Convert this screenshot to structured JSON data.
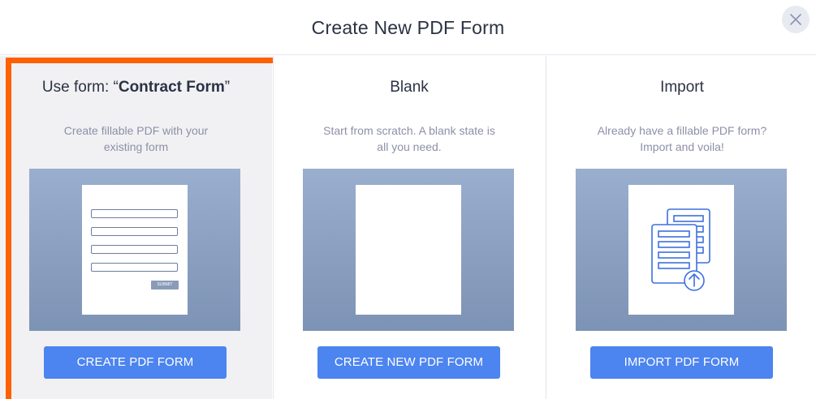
{
  "header": {
    "title": "Create New PDF Form",
    "close_icon": "close-icon"
  },
  "cards": [
    {
      "title_prefix": "Use form: “",
      "title_bold": "Contract Form",
      "title_suffix": "”",
      "description": "Create fillable PDF with your existing form",
      "preview": {
        "fields": 4,
        "submit_label": "SUBMIT"
      },
      "button_label": "CREATE PDF FORM",
      "selected": true,
      "highlight_color": "#ff6100"
    },
    {
      "title": "Blank",
      "description": "Start from scratch. A blank state is all you need.",
      "button_label": "CREATE NEW PDF FORM"
    },
    {
      "title": "Import",
      "description": "Already have a fillable PDF form? Import and voila!",
      "preview_icon": "import-document-icon",
      "button_label": "IMPORT PDF FORM"
    }
  ],
  "colors": {
    "accent": "#4c84f0",
    "selection": "#ff6100",
    "preview_gradient_top": "#9aaece",
    "preview_gradient_bottom": "#7d93b5"
  }
}
